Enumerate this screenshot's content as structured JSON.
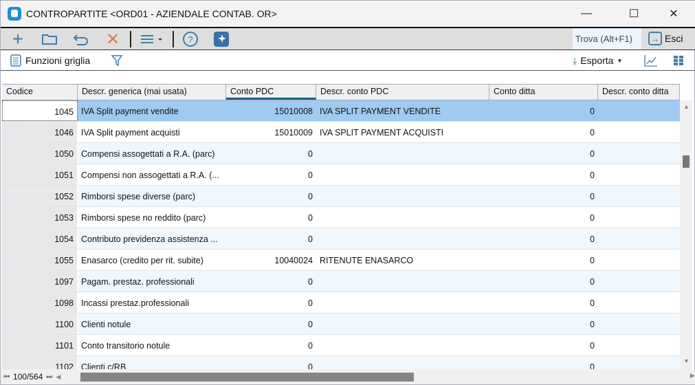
{
  "window": {
    "title": "CONTROPARTITE  <ORD01 - AZIENDALE CONTAB. OR>",
    "minimize": "—",
    "maximize": "☐",
    "close": "✕"
  },
  "toolbar": {
    "find_label": "Trova (Alt+F1)",
    "exit_label": "Esci"
  },
  "toolbar2": {
    "grid_functions": "Funzioni griglia",
    "export": "Esporta"
  },
  "grid": {
    "columns": [
      "Codice",
      "Descr. generica (mai usata)",
      "Conto PDC",
      "Descr. conto PDC",
      "Conto ditta",
      "Descr. conto ditta"
    ],
    "rows": [
      [
        "1045",
        "IVA Split payment vendite",
        "15010008",
        "IVA SPLIT PAYMENT VENDITE",
        "0",
        ""
      ],
      [
        "1046",
        "IVA Split payment acquisti",
        "15010009",
        "IVA SPLIT PAYMENT ACQUISTI",
        "0",
        ""
      ],
      [
        "1050",
        "Compensi assogettati a R.A. (parc)",
        "0",
        "",
        "0",
        ""
      ],
      [
        "1051",
        "Compensi non assogettati a R.A. (...",
        "0",
        "",
        "0",
        ""
      ],
      [
        "1052",
        "Rimborsi spese diverse (parc)",
        "0",
        "",
        "0",
        ""
      ],
      [
        "1053",
        "Rimborsi spese no reddito (parc)",
        "0",
        "",
        "0",
        ""
      ],
      [
        "1054",
        "Contributo previdenza assistenza ...",
        "0",
        "",
        "0",
        ""
      ],
      [
        "1055",
        "Enasarco (credito per rit. subite)",
        "10040024",
        "RITENUTE ENASARCO",
        "0",
        ""
      ],
      [
        "1097",
        "Pagam. prestaz. professionali",
        "0",
        "",
        "0",
        ""
      ],
      [
        "1098",
        "Incassi prestaz.professionali",
        "0",
        "",
        "0",
        ""
      ],
      [
        "1100",
        "Clienti notule",
        "0",
        "",
        "0",
        ""
      ],
      [
        "1101",
        "Conto transitorio notule",
        "0",
        "",
        "0",
        ""
      ],
      [
        "1102",
        "Clienti c/RB",
        "0",
        "",
        "0",
        ""
      ]
    ]
  },
  "pager": {
    "position": "100/564"
  }
}
